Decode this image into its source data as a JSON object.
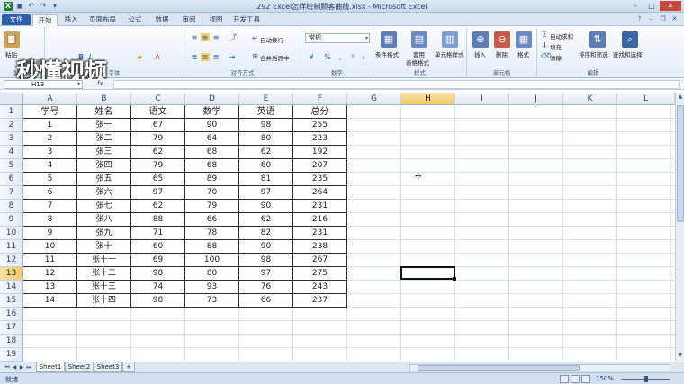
{
  "window": {
    "title": "292 Excel怎样绘制顾客曲线.xlsx - Microsoft Excel",
    "quick_access": [
      "save-icon",
      "undo-icon",
      "redo-icon",
      "dropdown-icon"
    ],
    "controls": [
      "minimize",
      "maximize",
      "close"
    ]
  },
  "ribbon": {
    "file_tab": "文件",
    "tabs": [
      "开始",
      "插入",
      "页面布局",
      "公式",
      "数据",
      "审阅",
      "视图",
      "开发工具"
    ],
    "active_tab": "开始",
    "groups": {
      "clipboard": {
        "label": "剪贴板",
        "paste": "粘贴",
        "format_painter": "格式刷"
      },
      "font": {
        "label": "字体"
      },
      "alignment": {
        "label": "对齐方式",
        "wrap_text": "自动换行",
        "merge_center": "合并后居中"
      },
      "number": {
        "label": "数字",
        "format_value": "常规",
        "percent": "%"
      },
      "styles": {
        "label": "样式",
        "conditional": "条件格式",
        "table_format_top": "套用",
        "table_format_bottom": "表格格式",
        "cell_styles": "单元格样式"
      },
      "cells": {
        "label": "单元格",
        "insert": "插入",
        "delete": "删除",
        "format": "格式"
      },
      "editing": {
        "label": "编辑",
        "autosum": "自动求和",
        "fill": "填充",
        "clear": "清除",
        "sort_filter": "排序和筛选",
        "find_select": "查找和选择"
      }
    }
  },
  "watermark": "秒懂视频",
  "formula_bar": {
    "name_box": "H13",
    "fx": "fx",
    "formula": ""
  },
  "columns": [
    "A",
    "B",
    "C",
    "D",
    "E",
    "F",
    "G",
    "H",
    "I",
    "J",
    "K",
    "L"
  ],
  "selected_column": "H",
  "rows": [
    "1",
    "2",
    "3",
    "4",
    "5",
    "6",
    "7",
    "8",
    "9",
    "10",
    "11",
    "12",
    "13",
    "14",
    "15",
    "16",
    "17",
    "18",
    "19"
  ],
  "selected_row": "13",
  "table": {
    "headers": [
      "学号",
      "姓名",
      "语文",
      "数学",
      "英语",
      "总分"
    ],
    "rows": [
      [
        "1",
        "张一",
        "67",
        "90",
        "98",
        "255"
      ],
      [
        "2",
        "张二",
        "79",
        "64",
        "80",
        "223"
      ],
      [
        "3",
        "张三",
        "62",
        "68",
        "62",
        "192"
      ],
      [
        "4",
        "张四",
        "79",
        "68",
        "60",
        "207"
      ],
      [
        "5",
        "张五",
        "65",
        "89",
        "81",
        "235"
      ],
      [
        "6",
        "张六",
        "97",
        "70",
        "97",
        "264"
      ],
      [
        "7",
        "张七",
        "62",
        "79",
        "90",
        "231"
      ],
      [
        "8",
        "张八",
        "88",
        "66",
        "62",
        "216"
      ],
      [
        "9",
        "张九",
        "71",
        "78",
        "82",
        "231"
      ],
      [
        "10",
        "张十",
        "60",
        "88",
        "90",
        "238"
      ],
      [
        "11",
        "张十一",
        "69",
        "100",
        "98",
        "267"
      ],
      [
        "12",
        "张十二",
        "98",
        "80",
        "97",
        "275"
      ],
      [
        "13",
        "张十三",
        "74",
        "93",
        "76",
        "243"
      ],
      [
        "14",
        "张十四",
        "98",
        "73",
        "66",
        "237"
      ]
    ]
  },
  "sheets": [
    "Sheet1",
    "Sheet2",
    "Sheet3"
  ],
  "active_sheet": "Sheet1",
  "status": {
    "mode": "就绪",
    "zoom": "150%"
  }
}
